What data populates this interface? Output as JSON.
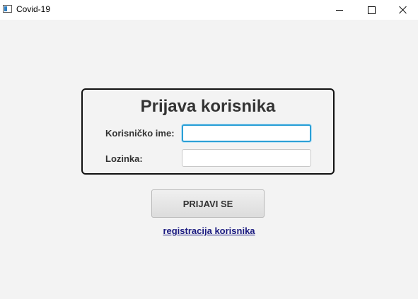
{
  "window": {
    "title": "Covid-19",
    "icon": "app-window-icon",
    "controls": {
      "minimize": "minimize-icon",
      "maximize": "maximize-icon",
      "close": "close-icon"
    }
  },
  "login": {
    "title": "Prijava korisnika",
    "username_label": "Korisničko ime:",
    "username_value": "",
    "password_label": "Lozinka:",
    "password_value": "",
    "submit_label": "PRIJAVI SE",
    "register_link": "registracija korisnika"
  },
  "colors": {
    "background": "#f3f3f3",
    "focus_border": "#2a9fd6",
    "link": "#1a1a80",
    "panel_border": "#111111"
  }
}
